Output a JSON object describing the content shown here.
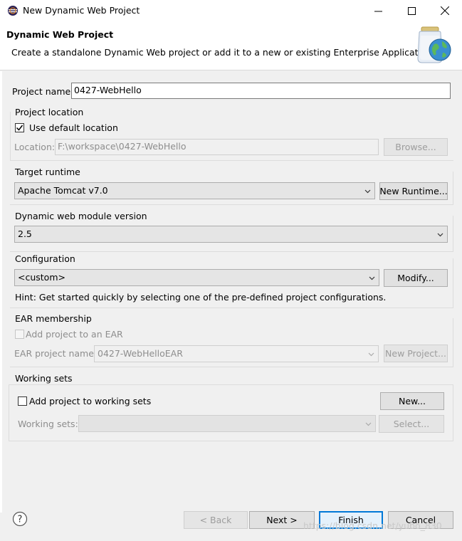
{
  "window": {
    "title": "New Dynamic Web Project",
    "icons": {
      "app": "eclipse-icon",
      "minimize": "minimize-icon",
      "maximize": "maximize-icon",
      "close": "close-icon"
    }
  },
  "banner": {
    "title": "Dynamic Web Project",
    "description": "Create a standalone Dynamic Web project or add it to a new or existing Enterprise Application.",
    "icon": "web-project-jar-globe-icon"
  },
  "project": {
    "name_label": "Project name:",
    "name_value": "0427-WebHello"
  },
  "location": {
    "group_label": "Project location",
    "use_default_label": "Use default location",
    "use_default_checked": true,
    "location_label": "Location:",
    "location_value": "F:\\workspace\\0427-WebHello",
    "browse_label": "Browse..."
  },
  "runtime": {
    "group_label": "Target runtime",
    "selected": "Apache Tomcat v7.0",
    "new_runtime_label": "New Runtime..."
  },
  "module_version": {
    "group_label": "Dynamic web module version",
    "selected": "2.5"
  },
  "configuration": {
    "group_label": "Configuration",
    "selected": "<custom>",
    "modify_label": "Modify...",
    "hint": "Hint: Get started quickly by selecting one of the pre-defined project configurations."
  },
  "ear": {
    "group_label": "EAR membership",
    "add_label": "Add project to an EAR",
    "add_checked": false,
    "project_name_label": "EAR project name:",
    "project_name_value": "0427-WebHelloEAR",
    "new_project_label": "New Project..."
  },
  "working_sets": {
    "group_label": "Working sets",
    "add_label": "Add project to working sets",
    "add_checked": false,
    "new_label": "New...",
    "sets_label": "Working sets:",
    "sets_value": "",
    "select_label": "Select..."
  },
  "footer": {
    "help_icon": "help-icon",
    "back_label": "< Back",
    "next_label": "Next >",
    "finish_label": "Finish",
    "cancel_label": "Cancel",
    "watermark": "https://blog.csdn.net/yubo_830"
  },
  "colors": {
    "accent": "#0078d7",
    "window_bg": "#f0f0f0",
    "banner_bg": "#ffffff"
  }
}
